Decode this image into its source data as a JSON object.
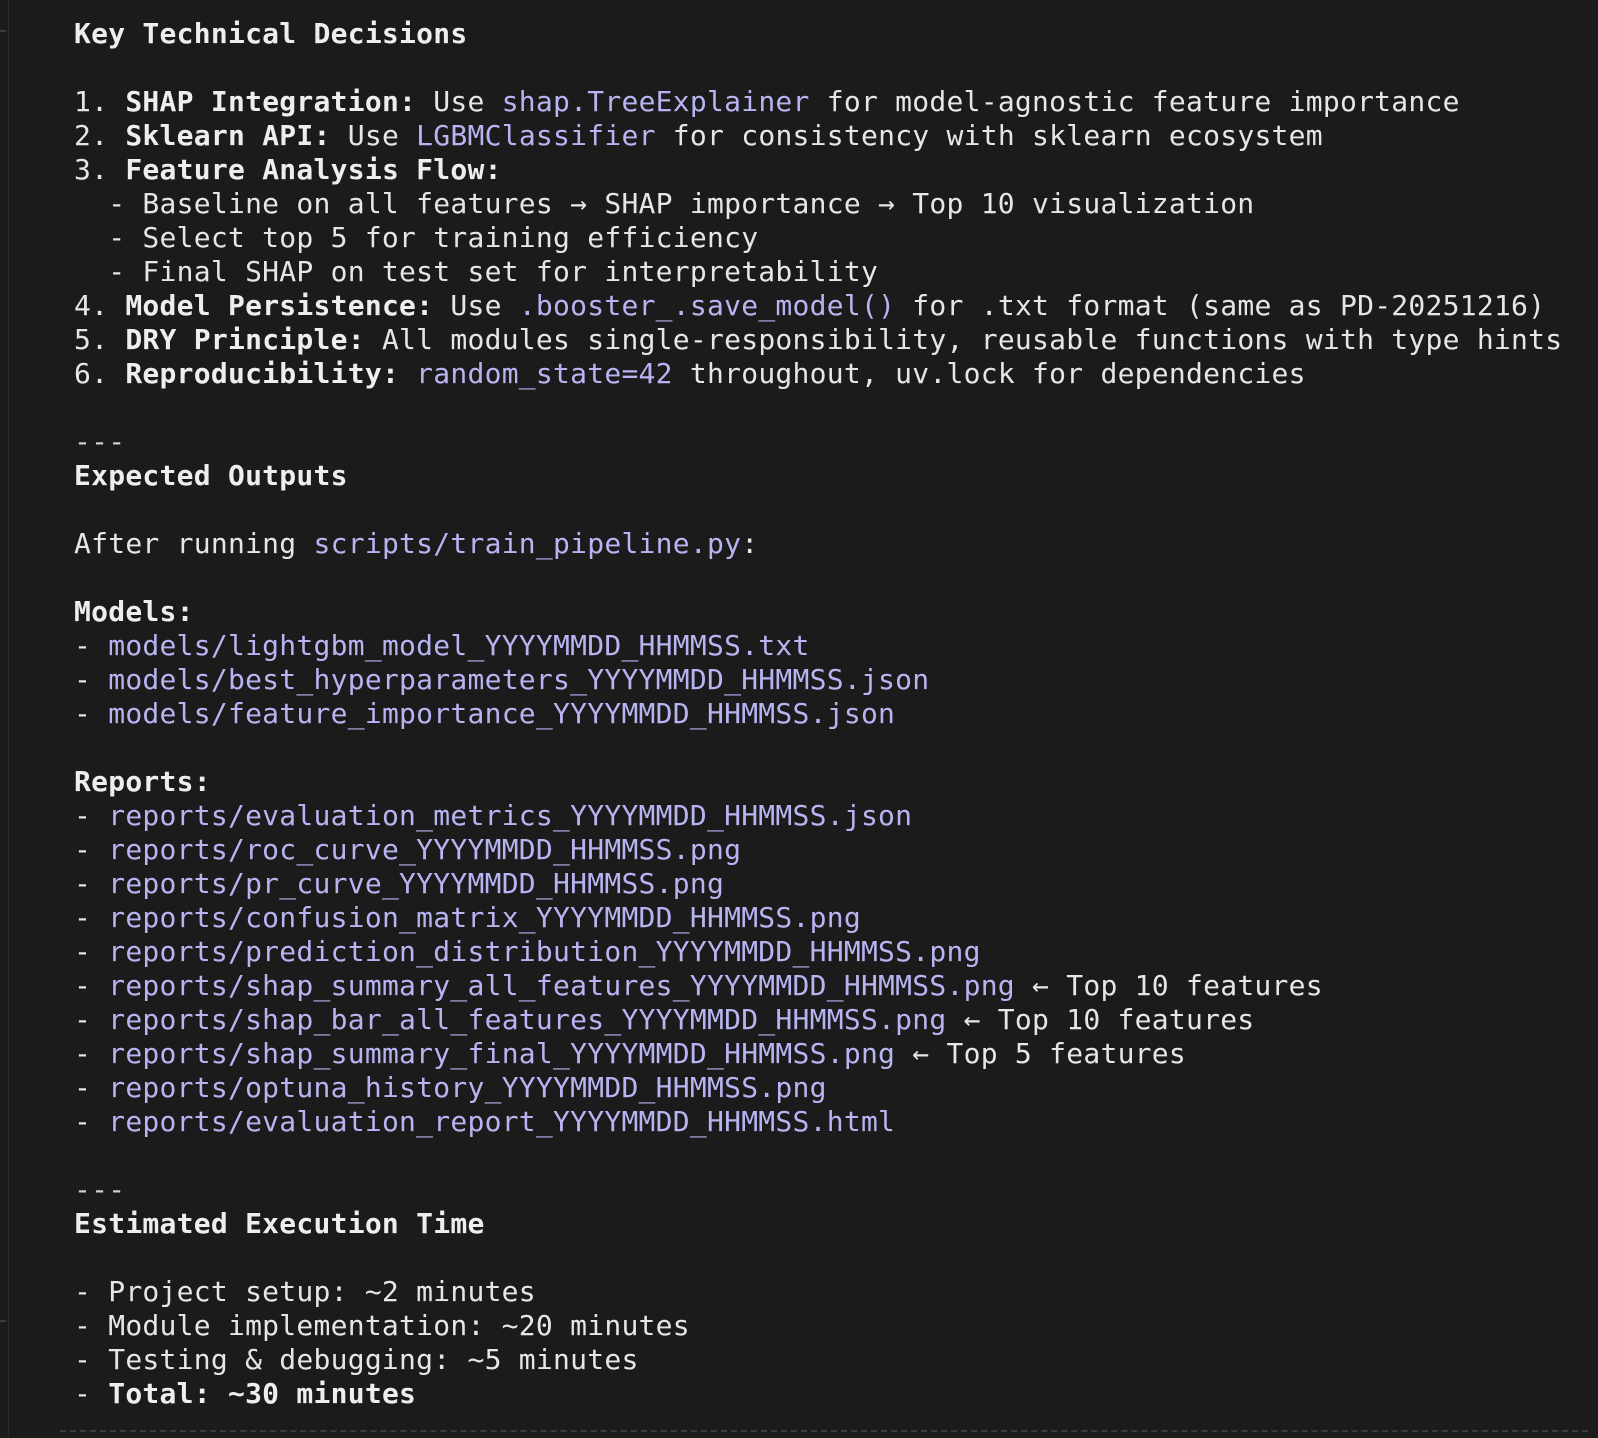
{
  "decisions": {
    "heading": "Key Technical Decisions",
    "items": [
      {
        "num": "1. ",
        "label": "SHAP Integration:",
        "pre": " Use ",
        "code": "shap.TreeExplainer",
        "post": " for model-agnostic feature importance"
      },
      {
        "num": "2. ",
        "label": "Sklearn API:",
        "pre": " Use ",
        "code": "LGBMClassifier",
        "post": " for consistency with sklearn ecosystem"
      },
      {
        "num": "3. ",
        "label": "Feature Analysis Flow:"
      },
      {
        "num": "4. ",
        "label": "Model Persistence:",
        "pre": " Use ",
        "code": ".booster_.save_model()",
        "post": " for .txt format (same as PD-20251216)"
      },
      {
        "num": "5. ",
        "label": "DRY Principle:",
        "post": " All modules single-responsibility, reusable functions with type hints"
      },
      {
        "num": "6. ",
        "label": "Reproducibility:",
        "pre": " ",
        "code": "random_state=42",
        "post": " throughout, uv.lock for dependencies"
      }
    ],
    "flow_steps": [
      "  - Baseline on all features → SHAP importance → Top 10 visualization",
      "  - Select top 5 for training efficiency",
      "  - Final SHAP on test set for interpretability"
    ]
  },
  "separator": "---",
  "outputs": {
    "heading": "Expected Outputs",
    "intro_pre": "After running ",
    "intro_code": "scripts/train_pipeline.py",
    "intro_post": ":",
    "models_heading": "Models:",
    "models": [
      "models/lightgbm_model_YYYYMMDD_HHMMSS.txt",
      "models/best_hyperparameters_YYYYMMDD_HHMMSS.json",
      "models/feature_importance_YYYYMMDD_HHMMSS.json"
    ],
    "reports_heading": "Reports:",
    "reports": [
      {
        "path": "reports/evaluation_metrics_YYYYMMDD_HHMMSS.json",
        "note": ""
      },
      {
        "path": "reports/roc_curve_YYYYMMDD_HHMMSS.png",
        "note": ""
      },
      {
        "path": "reports/pr_curve_YYYYMMDD_HHMMSS.png",
        "note": ""
      },
      {
        "path": "reports/confusion_matrix_YYYYMMDD_HHMMSS.png",
        "note": ""
      },
      {
        "path": "reports/prediction_distribution_YYYYMMDD_HHMMSS.png",
        "note": ""
      },
      {
        "path": "reports/shap_summary_all_features_YYYYMMDD_HHMMSS.png",
        "note": " ← Top 10 features"
      },
      {
        "path": "reports/shap_bar_all_features_YYYYMMDD_HHMMSS.png",
        "note": " ← Top 10 features"
      },
      {
        "path": "reports/shap_summary_final_YYYYMMDD_HHMMSS.png",
        "note": " ← Top 5 features"
      },
      {
        "path": "reports/optuna_history_YYYYMMDD_HHMMSS.png",
        "note": ""
      },
      {
        "path": "reports/evaluation_report_YYYYMMDD_HHMMSS.html",
        "note": ""
      }
    ]
  },
  "timing": {
    "heading": "Estimated Execution Time",
    "items": [
      "- Project setup: ~2 minutes",
      "- Module implementation: ~20 minutes",
      "- Testing & debugging: ~5 minutes"
    ],
    "total_prefix": "- ",
    "total_label": "Total: ~30 minutes"
  },
  "list_bullet": "- ",
  "colors": {
    "background": "#1b1b1b",
    "text": "#e6e6e6",
    "code": "#b8b4f2"
  }
}
